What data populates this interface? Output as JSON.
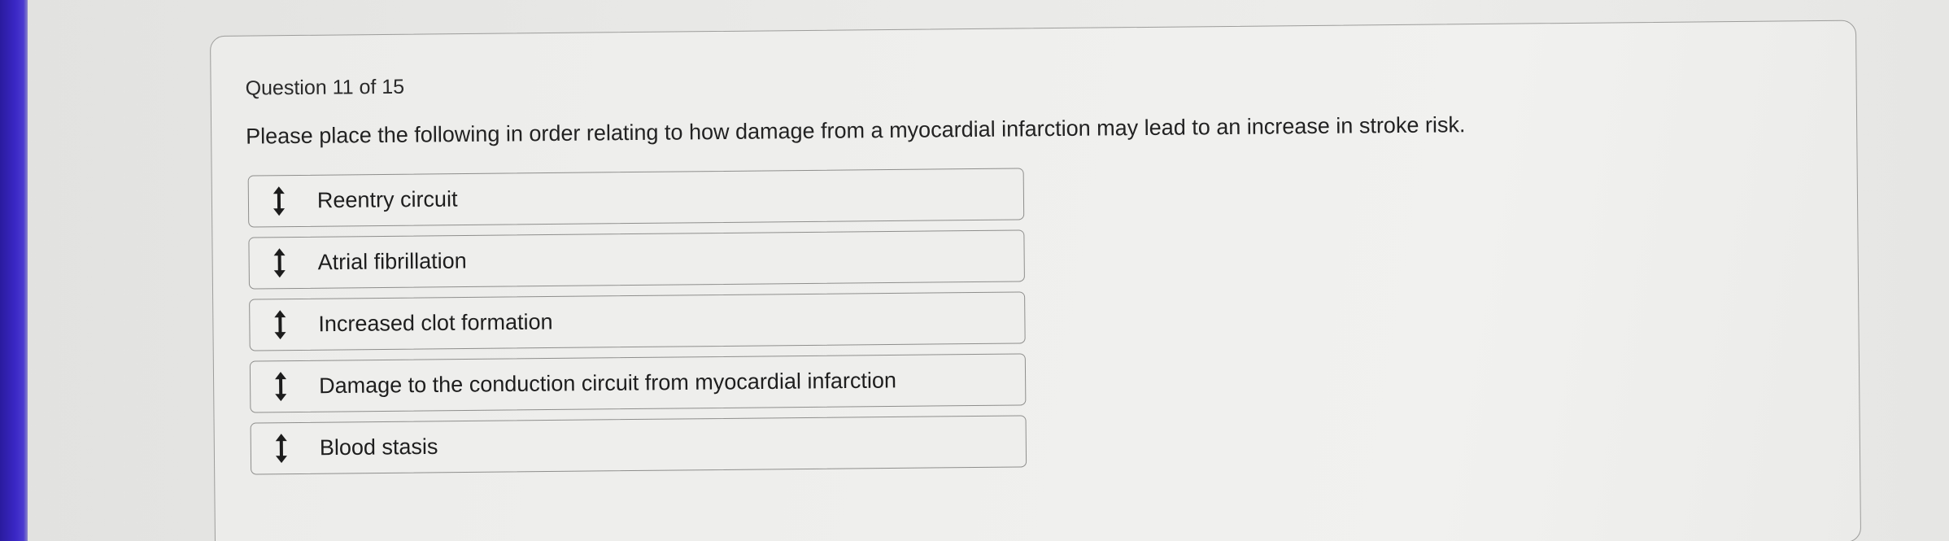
{
  "question": {
    "number_label": "Question 11 of 15",
    "prompt": "Please place the following in order relating to how damage from a myocardial infarction may lead to an increase in stroke risk."
  },
  "options": [
    {
      "label": "Reentry circuit",
      "icon": "drag-handle-icon"
    },
    {
      "label": "Atrial fibrillation",
      "icon": "drag-handle-icon"
    },
    {
      "label": "Increased clot formation",
      "icon": "drag-handle-icon"
    },
    {
      "label": "Damage to the conduction circuit from myocardial infarction",
      "icon": "drag-handle-icon"
    },
    {
      "label": "Blood stasis",
      "icon": "drag-handle-icon"
    }
  ],
  "colors": {
    "screen_edge": "#3a27c4",
    "card_background": "#efefed",
    "border": "#8e8e8c",
    "text": "#222222"
  }
}
